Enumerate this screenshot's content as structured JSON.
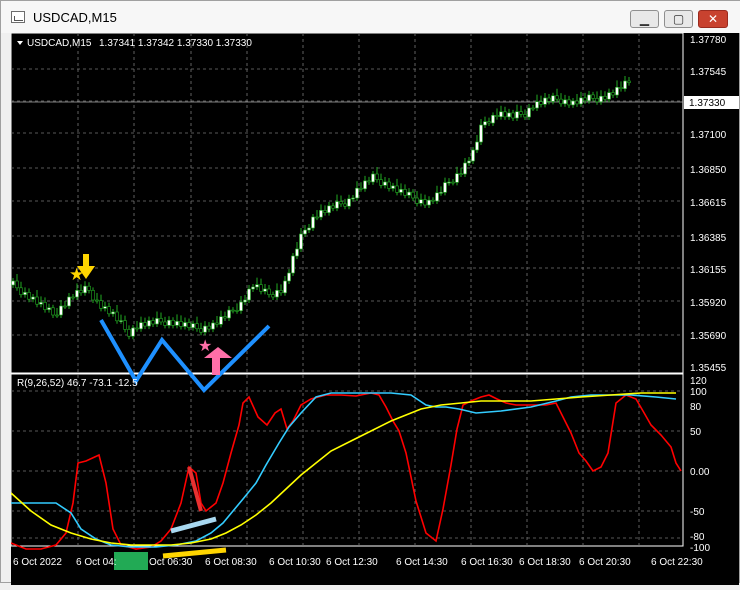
{
  "window": {
    "title": "USDCAD,M15",
    "buttons": [
      "min",
      "max",
      "close"
    ]
  },
  "header": {
    "symbol": "USDCAD,M15",
    "prices": "1.37341 1.37342 1.37330 1.37330",
    "current_price": "1.37330"
  },
  "price_axis": [
    "1.37780",
    "1.37545",
    "1.37330",
    "1.37100",
    "1.36850",
    "1.36615",
    "1.36385",
    "1.36155",
    "1.35920",
    "1.35690",
    "1.35455"
  ],
  "indicator": {
    "label": "R(9,26,52) 46.7 -73.1 -12.5",
    "axis": [
      "120",
      "100",
      "80",
      "50",
      "0.00",
      "-50",
      "-80",
      "-100"
    ]
  },
  "time_axis": [
    "6 Oct 2022",
    "6 Oct 04:",
    "Oct 06:30",
    "6 Oct 08:30",
    "6 Oct 10:30",
    "6 Oct 12:30",
    "6 Oct 14:30",
    "6 Oct 16:30",
    "6 Oct 18:30",
    "6 Oct 20:30",
    "6 Oct 22:30"
  ],
  "colors": {
    "background": "#000000",
    "candle": "#22aa22",
    "red_line": "#ff0000",
    "cyan_line": "#33ccff",
    "yellow_line": "#ffff00",
    "annotation_blue": "#1e90ff",
    "annotation_green": "#22aa55"
  },
  "chart_data": {
    "type": "line",
    "series": [
      {
        "name": "R(9,26,52)",
        "values": [
          46.7,
          -73.1,
          -12.5
        ]
      }
    ],
    "ylim": [
      1.35455,
      1.3778
    ]
  }
}
